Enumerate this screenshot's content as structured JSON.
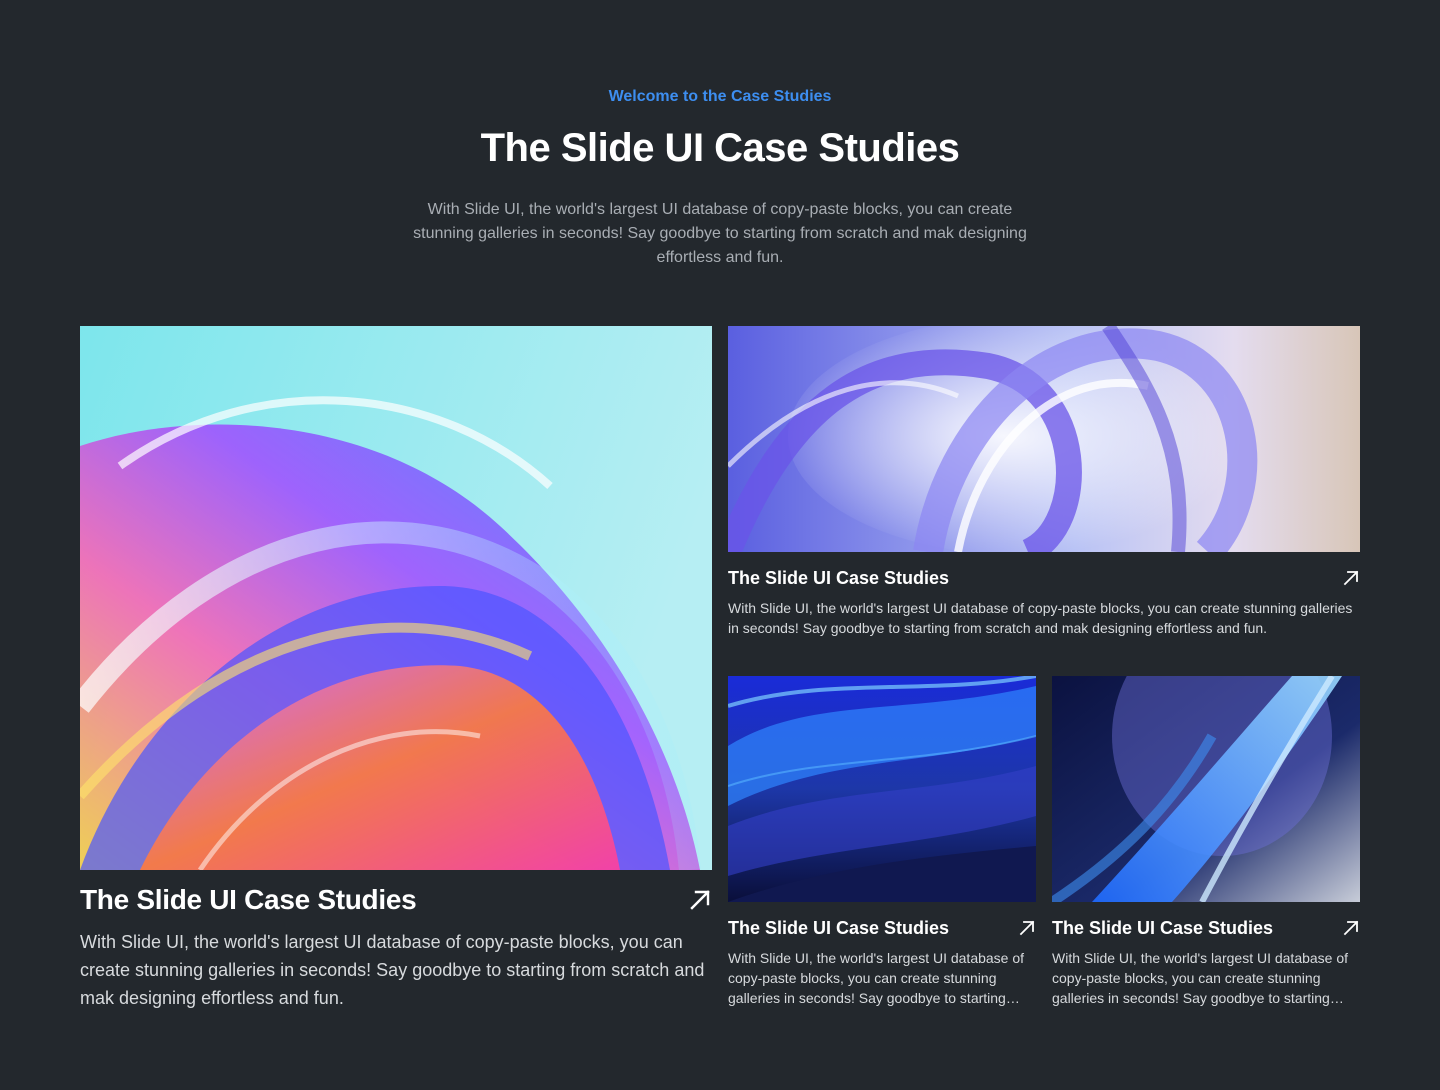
{
  "header": {
    "eyebrow": "Welcome to the Case Studies",
    "title": "The Slide UI Case Studies",
    "subtitle": "With Slide UI, the world's largest UI database of copy-paste blocks, you can create stunning galleries in seconds! Say goodbye to starting from scratch and mak designing effortless and fun."
  },
  "cards": [
    {
      "title": "The Slide UI Case Studies",
      "description": "With Slide UI, the world's largest UI database of copy-paste blocks, you can create stunning galleries in seconds! Say goodbye to starting from scratch and mak designing effortless and fun.",
      "icon": "arrow-up-right-icon"
    },
    {
      "title": "The Slide UI Case Studies",
      "description": "With Slide UI, the world's largest UI database of copy-paste blocks, you can create stunning galleries in seconds! Say goodbye to starting from scratch and mak designing effortless and fun.",
      "icon": "arrow-up-right-icon"
    },
    {
      "title": "The Slide UI Case Studies",
      "description": "With Slide UI, the world's largest UI database of copy-paste blocks, you can create stunning galleries in seconds! Say goodbye to starting from scratch and mak designing effortless and fun.",
      "icon": "arrow-up-right-icon"
    },
    {
      "title": "The Slide UI Case Studies",
      "description": "With Slide UI, the world's largest UI database of copy-paste blocks, you can create stunning galleries in seconds! Say goodbye to starting from scratch and mak designing effortless and fun.",
      "icon": "arrow-up-right-icon"
    }
  ],
  "colors": {
    "background": "#23282d",
    "accent": "#3d8ef0",
    "title": "#ffffff",
    "muted": "#a9aeb4"
  }
}
